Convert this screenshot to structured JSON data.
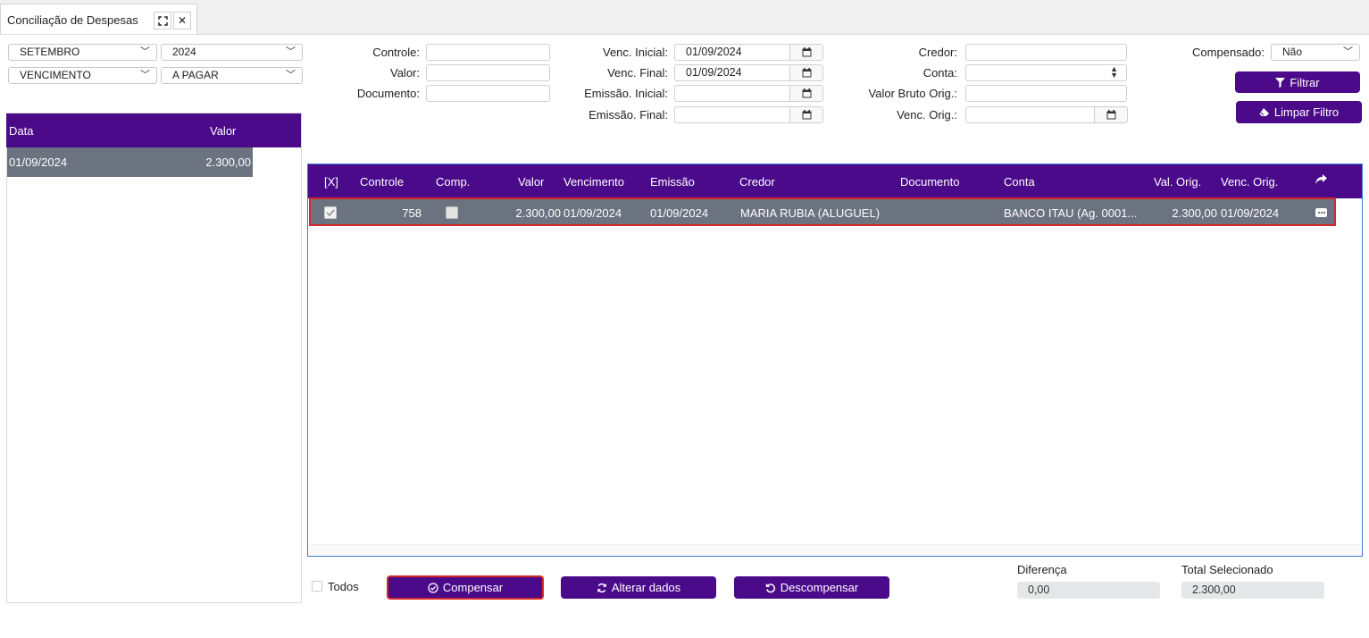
{
  "tab": {
    "title": "Conciliação de Despesas"
  },
  "filters": {
    "month": "SETEMBRO",
    "year": "2024",
    "date_type": "VENCIMENTO",
    "status": "A PAGAR",
    "controle_label": "Controle:",
    "controle_value": "",
    "valor_label": "Valor:",
    "valor_value": "",
    "documento_label": "Documento:",
    "documento_value": "",
    "venc_inicial_label": "Venc. Inicial:",
    "venc_inicial_value": "01/09/2024",
    "venc_final_label": "Venc. Final:",
    "venc_final_value": "01/09/2024",
    "emissao_inicial_label": "Emissão. Inicial:",
    "emissao_inicial_value": "",
    "emissao_final_label": "Emissão. Final:",
    "emissao_final_value": "",
    "credor_label": "Credor:",
    "credor_value": "",
    "conta_label": "Conta:",
    "conta_value": "",
    "valor_bruto_label": "Valor Bruto Orig.:",
    "valor_bruto_value": "",
    "venc_orig_label": "Venc. Orig.:",
    "venc_orig_value": "",
    "compensado_label": "Compensado:",
    "compensado_value": "Não",
    "filtrar_label": "Filtrar",
    "limpar_label": "Limpar Filtro"
  },
  "left_table": {
    "headers": {
      "data": "Data",
      "valor": "Valor"
    },
    "rows": [
      {
        "data": "01/09/2024",
        "valor": "2.300,00"
      }
    ]
  },
  "grid": {
    "headers": {
      "select": "[X]",
      "controle": "Controle",
      "comp": "Comp.",
      "valor": "Valor",
      "vencimento": "Vencimento",
      "emissao": "Emissão",
      "credor": "Credor",
      "documento": "Documento",
      "conta": "Conta",
      "val_orig": "Val. Orig.",
      "venc_orig": "Venc. Orig."
    },
    "rows": [
      {
        "selected": true,
        "controle": "758",
        "comp": false,
        "valor": "2.300,00",
        "vencimento": "01/09/2024",
        "emissao": "01/09/2024",
        "credor": "MARIA RUBIA (ALUGUEL)",
        "documento": "",
        "conta": "BANCO ITAU (Ag. 0001...",
        "val_orig": "2.300,00",
        "venc_orig": "01/09/2024"
      }
    ]
  },
  "footer": {
    "todos_label": "Todos",
    "compensar_label": "Compensar",
    "alterar_label": "Alterar dados",
    "descompensar_label": "Descompensar",
    "diferenca_label": "Diferença",
    "diferenca_value": "0,00",
    "total_label": "Total Selecionado",
    "total_value": "2.300,00"
  },
  "colors": {
    "primary": "#4b0a8a",
    "row_selected": "#6b7280",
    "highlight_border": "#d62828",
    "grid_border": "#3b7dd8"
  }
}
